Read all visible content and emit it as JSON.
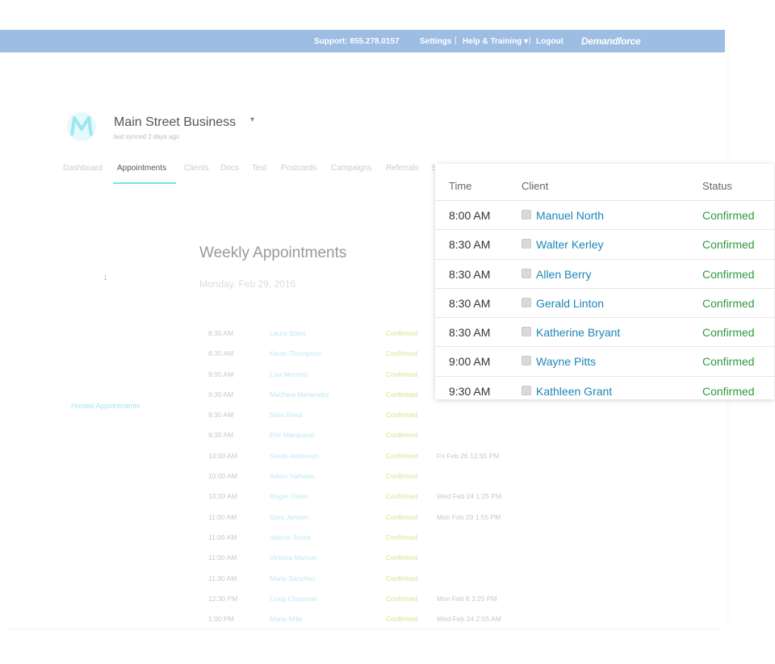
{
  "topbar": {
    "support": "Support:  855.278.0157",
    "settings": "Settings",
    "help": "Help & Training ▾",
    "logout": "Logout",
    "brand": "Demandforce",
    "sep": "|"
  },
  "business": {
    "name": "Main Street Business",
    "caret": "▾",
    "synced": "last synced 2 days ago",
    "logo_letter": "M",
    "dot": "·"
  },
  "nav": [
    "Dashboard",
    "Appointments",
    "Clients",
    "Docs",
    "Text",
    "Postcards",
    "Campaigns",
    "Referrals",
    "S"
  ],
  "sidebar": {
    "faint": "· · · · · · · · · · · · · · · · · ·",
    "one": "1",
    "hosted_link": "Hosted Appointments"
  },
  "weekly": {
    "title": "Weekly Appointments",
    "date": "Monday, Feb 29, 2016"
  },
  "bg_rows": [
    {
      "time": "8:30 AM",
      "client": "Laura Stiles",
      "status": "Confirmed",
      "note": ""
    },
    {
      "time": "8:30 AM",
      "client": "Kevin Thompson",
      "status": "Confirmed",
      "note": ""
    },
    {
      "time": "9:00 AM",
      "client": "Lisa Moreno",
      "status": "Confirmed",
      "note": ""
    },
    {
      "time": "9:30 AM",
      "client": "Matthew Menendez",
      "status": "Confirmed",
      "note": ""
    },
    {
      "time": "9:30 AM",
      "client": "Sara Reed",
      "status": "Confirmed",
      "note": ""
    },
    {
      "time": "9:30 AM",
      "client": "Eric Marquand",
      "status": "Confirmed",
      "note": ""
    },
    {
      "time": "10:00 AM",
      "client": "Sarah Anderson",
      "status": "Confirmed",
      "note": "Fri Feb 26 12:55 PM"
    },
    {
      "time": "10:00 AM",
      "client": "Adam Yamada",
      "status": "Confirmed",
      "note": ""
    },
    {
      "time": "10:30 AM",
      "client": "Roger Olsen",
      "status": "Confirmed",
      "note": "Wed Feb 24 1:25 PM"
    },
    {
      "time": "11:00 AM",
      "client": "Sara Jensen",
      "status": "Confirmed",
      "note": "Mon Feb 29 1:55 PM"
    },
    {
      "time": "11:00 AM",
      "client": "Valerie Jones",
      "status": "Confirmed",
      "note": ""
    },
    {
      "time": "11:00 AM",
      "client": "Victoria Manuel",
      "status": "Confirmed",
      "note": ""
    },
    {
      "time": "11:30 AM",
      "client": "Maria Sanchez",
      "status": "Confirmed",
      "note": ""
    },
    {
      "time": "12:30 PM",
      "client": "Craig Chapman",
      "status": "Confirmed",
      "note": "Mon Feb 8 3:25 PM"
    },
    {
      "time": "1:00 PM",
      "client": "Maria Mills",
      "status": "Confirmed",
      "note": "Wed Feb 24 2:55 AM"
    }
  ],
  "panel": {
    "headers": {
      "time": "Time",
      "client": "Client",
      "status": "Status"
    },
    "rows": [
      {
        "time": "8:00 AM",
        "client": "Manuel North",
        "status": "Confirmed"
      },
      {
        "time": "8:30 AM",
        "client": "Walter Kerley",
        "status": "Confirmed"
      },
      {
        "time": "8:30 AM",
        "client": "Allen Berry",
        "status": "Confirmed"
      },
      {
        "time": "8:30 AM",
        "client": "Gerald Linton",
        "status": "Confirmed"
      },
      {
        "time": "8:30 AM",
        "client": "Katherine Bryant",
        "status": "Confirmed"
      },
      {
        "time": "9:00 AM",
        "client": "Wayne Pitts",
        "status": "Confirmed"
      },
      {
        "time": "9:30 AM",
        "client": "Kathleen Grant",
        "status": "Confirmed"
      }
    ]
  },
  "colors": {
    "topbar": "#9dbde3",
    "accent": "#7ee0ee",
    "link": "#1c86b8",
    "confirmed": "#2e9b3c"
  }
}
